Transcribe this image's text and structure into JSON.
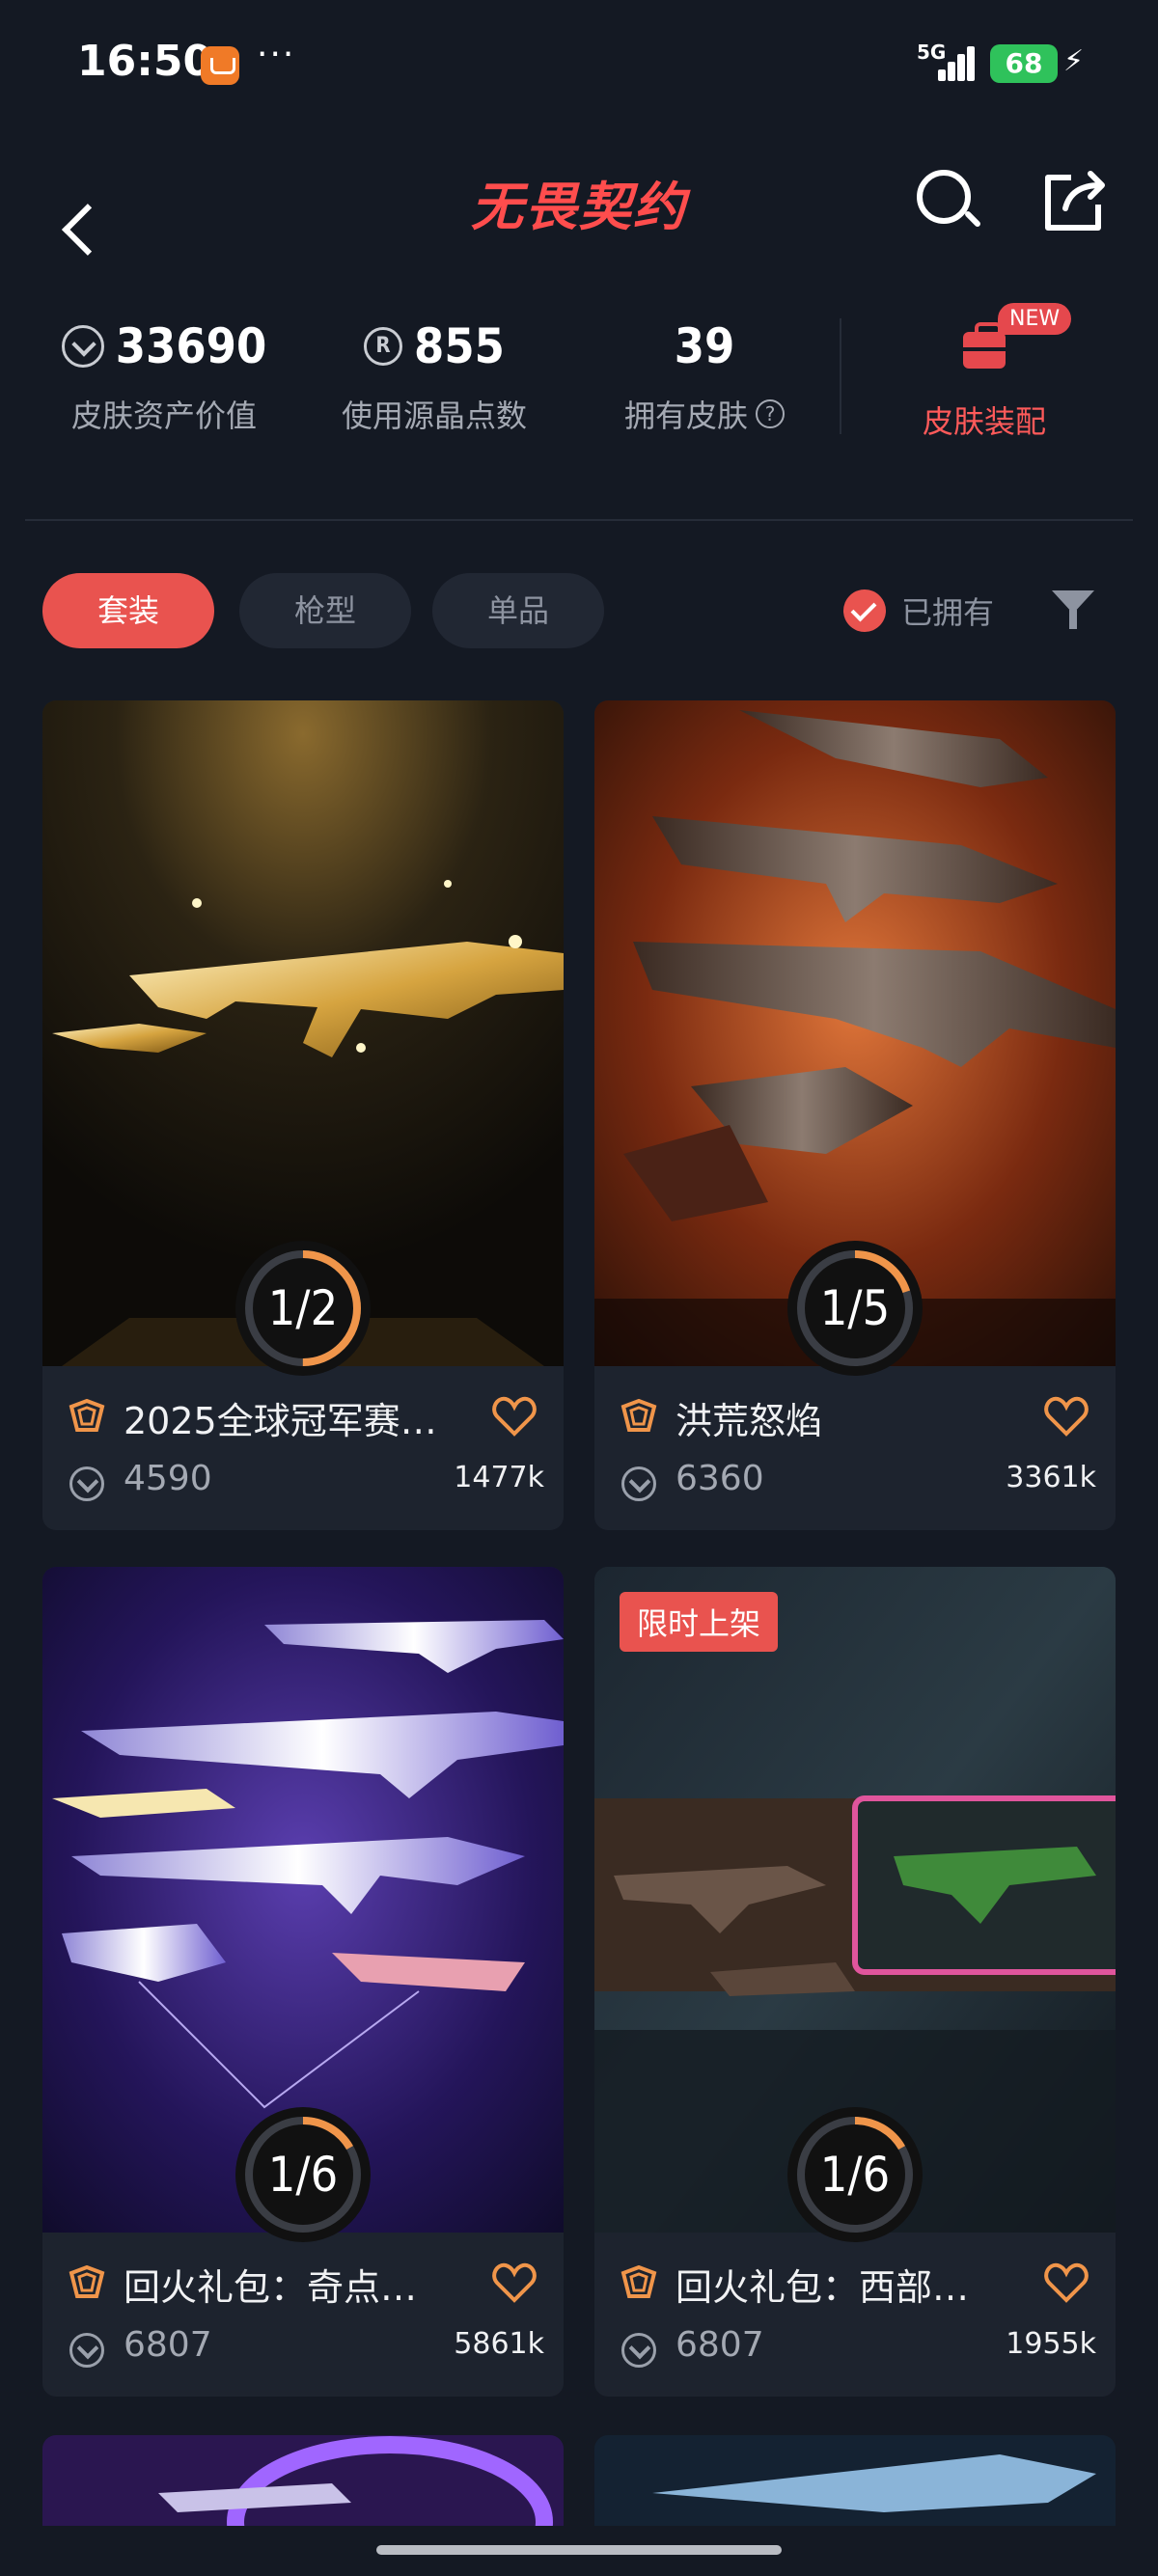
{
  "status_bar": {
    "time": "16:50",
    "dots": "···",
    "network": "5G",
    "battery": "68"
  },
  "header": {
    "title": "无畏契约",
    "icons": [
      "back-icon",
      "search-icon",
      "share-icon"
    ]
  },
  "stats": {
    "asset_value": "33690",
    "asset_label": "皮肤资产价值",
    "radianite_points": "855",
    "radianite_label": "使用源晶点数",
    "skins_owned": "39",
    "skins_label": "拥有皮肤",
    "help_mark": "?",
    "equip_label": "皮肤装配",
    "new_badge": "NEW",
    "radianite_mark": "R"
  },
  "filters": {
    "tabs": [
      "套装",
      "枪型",
      "单品"
    ],
    "active_tab": "套装",
    "owned_label": "已拥有"
  },
  "cards": [
    {
      "name": "2025全球冠军赛…",
      "price": "4590",
      "likes": "1477k",
      "progress": "1/2",
      "owned": 1,
      "total": 2,
      "badge": ""
    },
    {
      "name": "洪荒怒焰",
      "price": "6360",
      "likes": "3361k",
      "progress": "1/5",
      "owned": 1,
      "total": 5,
      "badge": ""
    },
    {
      "name": "回火礼包：奇点…",
      "price": "6807",
      "likes": "5861k",
      "progress": "1/6",
      "owned": 1,
      "total": 6,
      "badge": ""
    },
    {
      "name": "回火礼包：西部…",
      "price": "6807",
      "likes": "1955k",
      "progress": "1/6",
      "owned": 1,
      "total": 6,
      "badge": "限时上架"
    }
  ],
  "colors": {
    "accent": "#e9534f",
    "background": "#141923",
    "card": "#1d232e",
    "ring_progress": "#f0954a"
  }
}
